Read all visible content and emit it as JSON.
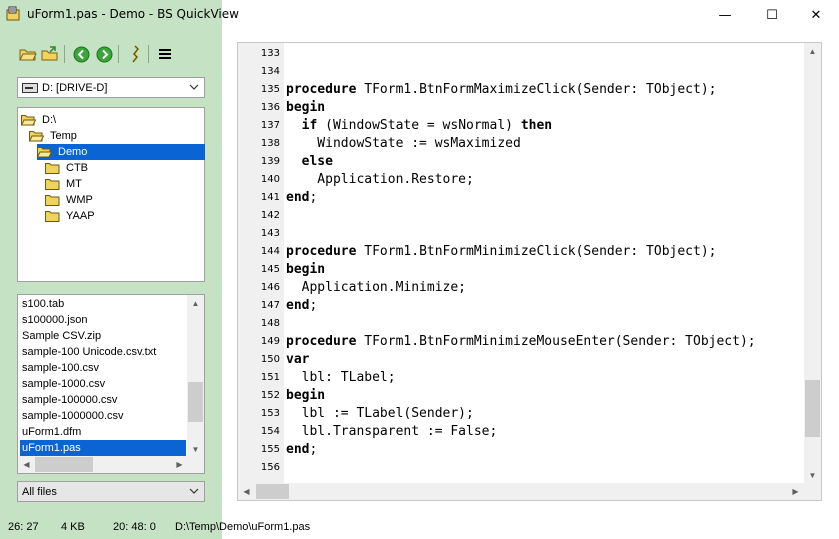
{
  "window": {
    "title": "uForm1.pas - Demo - BS QuickView",
    "minimize_glyph": "—",
    "maximize_glyph": "☐",
    "close_glyph": "✕"
  },
  "toolbar": {
    "buttons": [
      {
        "name": "open-folder-icon"
      },
      {
        "name": "open-file-icon"
      },
      {
        "name": "back-icon"
      },
      {
        "name": "forward-icon"
      },
      {
        "name": "info-icon"
      },
      {
        "name": "menu-icon"
      }
    ]
  },
  "drive": {
    "selected": "D: [DRIVE-D]"
  },
  "tree": {
    "items": [
      {
        "label": "D:\\",
        "level": 0,
        "open": true
      },
      {
        "label": "Temp",
        "level": 1,
        "open": true
      },
      {
        "label": "Demo",
        "level": 2,
        "open": true,
        "selected": true
      },
      {
        "label": "CTB",
        "level": 3
      },
      {
        "label": "MT",
        "level": 3
      },
      {
        "label": "WMP",
        "level": 3
      },
      {
        "label": "YAAP",
        "level": 3
      }
    ]
  },
  "files": {
    "items": [
      "s100.tab",
      "s100000.json",
      "Sample CSV.zip",
      "sample-100 Unicode.csv.txt",
      "sample-100.csv",
      "sample-1000.csv",
      "sample-100000.csv",
      "sample-1000000.csv",
      "uForm1.dfm",
      "uForm1.pas"
    ],
    "selected_index": 9
  },
  "filter": {
    "selected": "All files"
  },
  "status": {
    "position": "26: 27",
    "size": "4 KB",
    "time": "20: 48: 0",
    "path": "D:\\Temp\\Demo\\uForm1.pas"
  },
  "editor": {
    "lines": [
      {
        "n": "133",
        "segs": []
      },
      {
        "n": "134",
        "segs": []
      },
      {
        "n": "135",
        "segs": [
          {
            "k": true,
            "t": "procedure"
          },
          {
            "t": " TForm1.BtnFormMaximizeClick(Sender: TObject);"
          }
        ]
      },
      {
        "n": "136",
        "segs": [
          {
            "k": true,
            "t": "begin"
          }
        ]
      },
      {
        "n": "137",
        "segs": [
          {
            "t": "  "
          },
          {
            "k": true,
            "t": "if"
          },
          {
            "t": " (WindowState = wsNormal) "
          },
          {
            "k": true,
            "t": "then"
          }
        ]
      },
      {
        "n": "138",
        "segs": [
          {
            "t": "    WindowState := wsMaximized"
          }
        ]
      },
      {
        "n": "139",
        "segs": [
          {
            "t": "  "
          },
          {
            "k": true,
            "t": "else"
          }
        ]
      },
      {
        "n": "140",
        "segs": [
          {
            "t": "    Application.Restore;"
          }
        ]
      },
      {
        "n": "141",
        "segs": [
          {
            "k": true,
            "t": "end"
          },
          {
            "t": ";"
          }
        ]
      },
      {
        "n": "142",
        "segs": []
      },
      {
        "n": "143",
        "segs": []
      },
      {
        "n": "144",
        "segs": [
          {
            "k": true,
            "t": "procedure"
          },
          {
            "t": " TForm1.BtnFormMinimizeClick(Sender: TObject);"
          }
        ]
      },
      {
        "n": "145",
        "segs": [
          {
            "k": true,
            "t": "begin"
          }
        ]
      },
      {
        "n": "146",
        "segs": [
          {
            "t": "  Application.Minimize;"
          }
        ]
      },
      {
        "n": "147",
        "segs": [
          {
            "k": true,
            "t": "end"
          },
          {
            "t": ";"
          }
        ]
      },
      {
        "n": "148",
        "segs": []
      },
      {
        "n": "149",
        "segs": [
          {
            "k": true,
            "t": "procedure"
          },
          {
            "t": " TForm1.BtnFormMinimizeMouseEnter(Sender: TObject);"
          }
        ]
      },
      {
        "n": "150",
        "segs": [
          {
            "k": true,
            "t": "var"
          }
        ]
      },
      {
        "n": "151",
        "segs": [
          {
            "t": "  lbl: TLabel;"
          }
        ]
      },
      {
        "n": "152",
        "segs": [
          {
            "k": true,
            "t": "begin"
          }
        ]
      },
      {
        "n": "153",
        "segs": [
          {
            "t": "  lbl := TLabel(Sender);"
          }
        ]
      },
      {
        "n": "154",
        "segs": [
          {
            "t": "  lbl.Transparent := False;"
          }
        ]
      },
      {
        "n": "155",
        "segs": [
          {
            "k": true,
            "t": "end"
          },
          {
            "t": ";"
          }
        ]
      },
      {
        "n": "156",
        "segs": []
      }
    ]
  },
  "colors": {
    "panel_green": "#c5e2c4",
    "selection_blue": "#0a64d4"
  }
}
